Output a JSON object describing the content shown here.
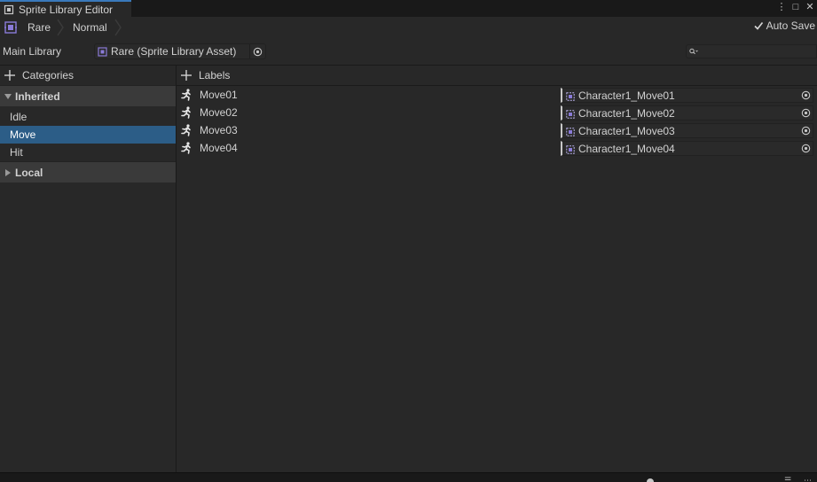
{
  "window": {
    "tab_title": "Sprite Library Editor",
    "actions": {
      "more": "⋮",
      "maximize": "□",
      "close": "✕"
    }
  },
  "toolbar": {
    "breadcrumbs": [
      "Rare",
      "Normal"
    ],
    "autosave_label": "Auto Save",
    "autosave_checked": true
  },
  "main_library": {
    "label": "Main Library",
    "value": "Rare (Sprite Library Asset)",
    "search_placeholder": ""
  },
  "categories": {
    "title": "Categories",
    "groups": [
      {
        "name": "Inherited",
        "expanded": true,
        "items": [
          "Idle",
          "Move",
          "Hit"
        ]
      },
      {
        "name": "Local",
        "expanded": false,
        "items": []
      }
    ],
    "selected": "Move"
  },
  "labels": {
    "title": "Labels",
    "rows": [
      {
        "name": "Move01",
        "sprite": "Character1_Move01"
      },
      {
        "name": "Move02",
        "sprite": "Character1_Move02"
      },
      {
        "name": "Move03",
        "sprite": "Character1_Move03"
      },
      {
        "name": "Move04",
        "sprite": "Character1_Move04"
      }
    ]
  },
  "colors": {
    "selection": "#2c5d87",
    "tab_accent": "#3a79bb",
    "sprite_icon": "#8a7bd8"
  }
}
